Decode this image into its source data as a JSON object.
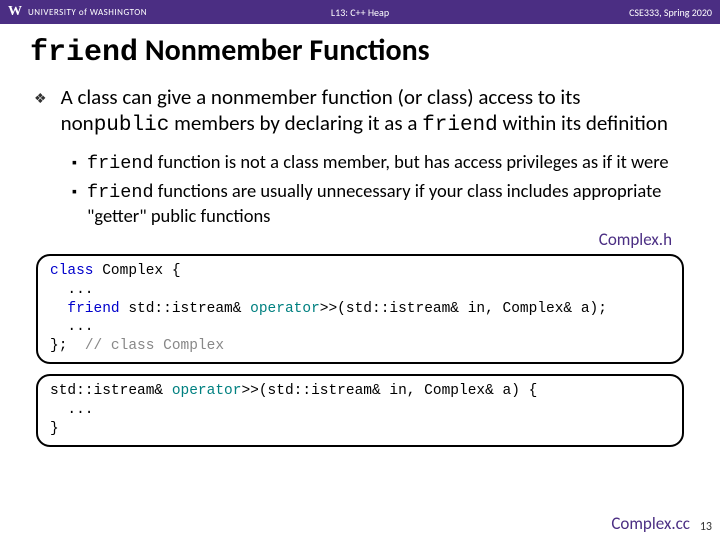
{
  "header": {
    "logo": "W",
    "university": "UNIVERSITY of WASHINGTON",
    "center": "L13: C++ Heap",
    "right": "CSE333, Spring 2020"
  },
  "title": {
    "mono": "friend",
    "rest": " Nonmember Functions"
  },
  "main_bullet": {
    "p1": "A class can give a nonmember function (or class) access to its non",
    "p2": "public",
    "p3": " members by declaring it as a ",
    "p4": "friend",
    "p5": " within its definition"
  },
  "sub1": {
    "p1": "friend",
    "p2": " function is not a class member, but has access privileges as if it were"
  },
  "sub2": {
    "p1": "friend",
    "p2": " functions are usually unnecessary if your class includes appropriate \"getter\" public functions"
  },
  "file1": "Complex.h",
  "file2": "Complex.cc",
  "code1": {
    "l1a": "class",
    "l1b": " Complex {",
    "l2": "  ...",
    "l3a": "  friend",
    "l3b": " std::istream& ",
    "l3c": "operator",
    "l3d": ">>(std::istream& in, Complex& a);",
    "l4": "  ...",
    "l5a": "};  ",
    "l5b": "// class Complex"
  },
  "code2": {
    "l1a": "std::istream& ",
    "l1b": "operator",
    "l1c": ">>(std::istream& in, Complex& a) {",
    "l2": "  ...",
    "l3": "}"
  },
  "page_num": "13"
}
